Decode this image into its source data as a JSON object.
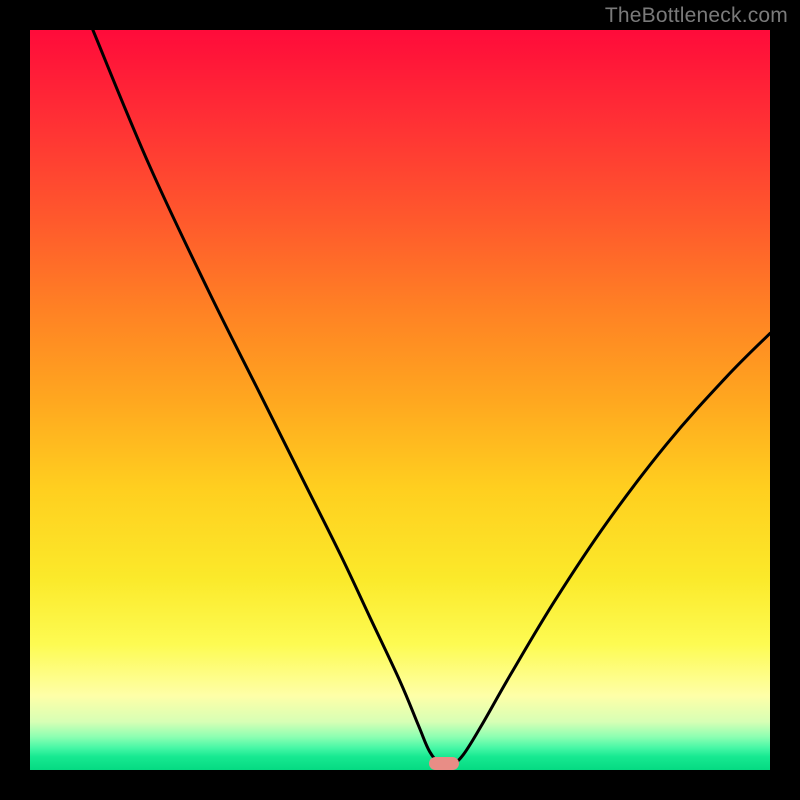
{
  "watermark": "TheBottleneck.com",
  "colors": {
    "frame": "#000000",
    "gradient_top": "#ff0b3a",
    "gradient_bottom": "#05da82",
    "curve": "#000000",
    "trough_marker": "#e88d86",
    "watermark_text": "#7a7a7a"
  },
  "chart_data": {
    "type": "line",
    "title": "",
    "xlabel": "",
    "ylabel": "",
    "xlim": [
      0,
      100
    ],
    "ylim": [
      0,
      100
    ],
    "grid": false,
    "note": "Axes are unlabeled; values inferred from geometry (x,y as percent of plot width/height; y=0 at bottom).",
    "series": [
      {
        "name": "bottleneck-curve",
        "points": [
          {
            "x": 8.5,
            "y": 100.0
          },
          {
            "x": 16.0,
            "y": 82.0
          },
          {
            "x": 24.0,
            "y": 65.0
          },
          {
            "x": 31.0,
            "y": 51.0
          },
          {
            "x": 37.0,
            "y": 39.0
          },
          {
            "x": 42.0,
            "y": 29.0
          },
          {
            "x": 46.0,
            "y": 20.5
          },
          {
            "x": 50.0,
            "y": 12.0
          },
          {
            "x": 52.5,
            "y": 6.0
          },
          {
            "x": 54.0,
            "y": 2.5
          },
          {
            "x": 55.5,
            "y": 0.8
          },
          {
            "x": 57.0,
            "y": 0.8
          },
          {
            "x": 58.5,
            "y": 2.0
          },
          {
            "x": 61.0,
            "y": 6.0
          },
          {
            "x": 65.0,
            "y": 13.0
          },
          {
            "x": 71.0,
            "y": 23.0
          },
          {
            "x": 78.0,
            "y": 33.5
          },
          {
            "x": 86.0,
            "y": 44.0
          },
          {
            "x": 94.0,
            "y": 53.0
          },
          {
            "x": 100.0,
            "y": 59.0
          }
        ]
      }
    ],
    "trough": {
      "x": 56.0,
      "y": 0.8
    }
  }
}
